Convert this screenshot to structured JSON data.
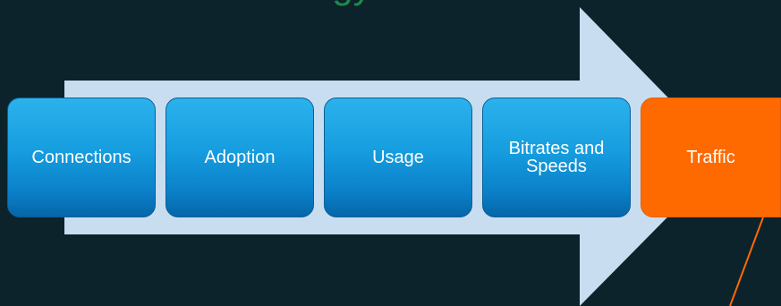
{
  "title": "Forecast Methodology",
  "steps": [
    {
      "label": "Connections"
    },
    {
      "label": "Adoption"
    },
    {
      "label": "Usage"
    },
    {
      "label": "Bitrates and Speeds"
    },
    {
      "label": "Traffic"
    }
  ],
  "colors": {
    "background": "#0c232b",
    "title": "#1e8a4a",
    "arrow": "#c9ddf0",
    "step_blue": "#169ddf",
    "step_highlight": "#ff6a00",
    "connector": "#ff6a00"
  }
}
